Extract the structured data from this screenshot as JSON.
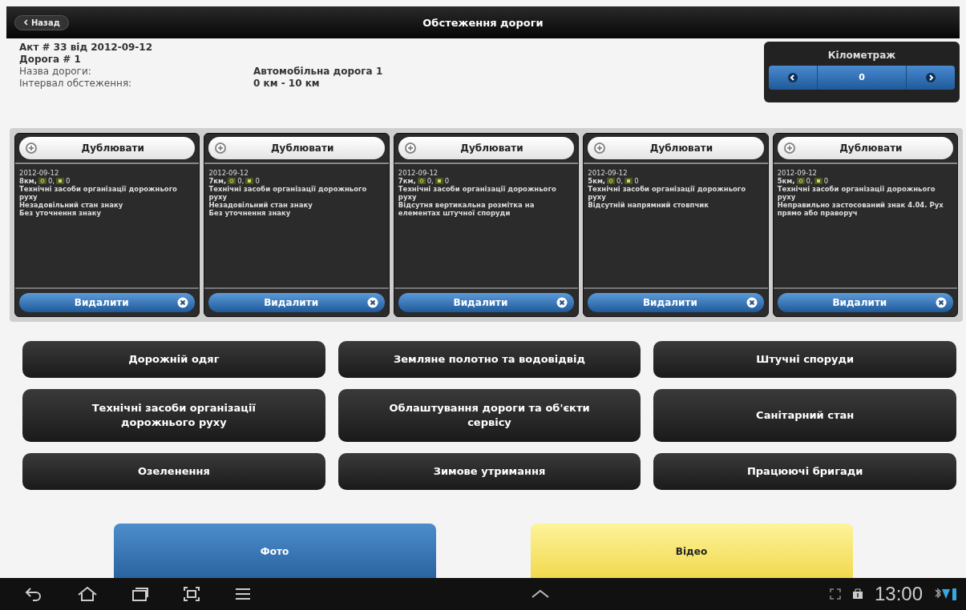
{
  "top_bar": {
    "back_button": "Назад",
    "title": "Обстеження дороги"
  },
  "act": {
    "title": "Акт # 33 від 2012-09-12",
    "road": "Дорога # 1",
    "fields": [
      {
        "label": "Назва дороги:",
        "value": "Автомобільна дорога 1"
      },
      {
        "label": "Інтервал обстеження:",
        "value": "0 км - 10 км"
      }
    ]
  },
  "mileage": {
    "title": "Кілометраж",
    "value": "0"
  },
  "cards": [
    {
      "duplicate": "Дублювати",
      "date": "2012-09-12",
      "km": "8км,",
      "count_1": "0,",
      "count_2": "0",
      "lines": [
        "Технічні засоби організації дорожнього руху",
        "Незадовільний стан знаку",
        "Без уточнення знаку"
      ],
      "delete": "Видалити"
    },
    {
      "duplicate": "Дублювати",
      "date": "2012-09-12",
      "km": "7км,",
      "count_1": "0,",
      "count_2": "0",
      "lines": [
        "Технічні засоби організації дорожнього руху",
        "Незадовільний стан знаку",
        "Без уточнення знаку"
      ],
      "delete": "Видалити"
    },
    {
      "duplicate": "Дублювати",
      "date": "2012-09-12",
      "km": "7км,",
      "count_1": "0,",
      "count_2": "0",
      "lines": [
        "Технічні засоби організації дорожнього руху",
        "Відсутня вертикальна розмітка на елементах штучної споруди"
      ],
      "delete": "Видалити"
    },
    {
      "duplicate": "Дублювати",
      "date": "2012-09-12",
      "km": "5км,",
      "count_1": "0,",
      "count_2": "0",
      "lines": [
        "Технічні засоби організації дорожнього руху",
        "Відсутній напрямний стовпчик"
      ],
      "delete": "Видалити"
    },
    {
      "duplicate": "Дублювати",
      "date": "2012-09-12",
      "km": "5км,",
      "count_1": "0,",
      "count_2": "0",
      "lines": [
        "Технічні засоби організації дорожнього руху",
        "Неправильно застосований знак 4.04. Рух прямо або праворуч"
      ],
      "delete": "Видалити"
    }
  ],
  "categories": [
    "Дорожній одяг",
    "Земляне полотно та водовідвід",
    "Штучні споруди",
    "Технічні засоби організації дорожнього руху",
    "Облаштування дороги та об'єкти сервісу",
    "Санітарний стан",
    "Озеленення",
    "Зимове утримання",
    "Працюючі бригади"
  ],
  "media_buttons": [
    {
      "label": "Фото",
      "kind": "photo"
    },
    {
      "label": "Відео",
      "kind": "video"
    }
  ],
  "system_bar": {
    "time": "13:00"
  }
}
